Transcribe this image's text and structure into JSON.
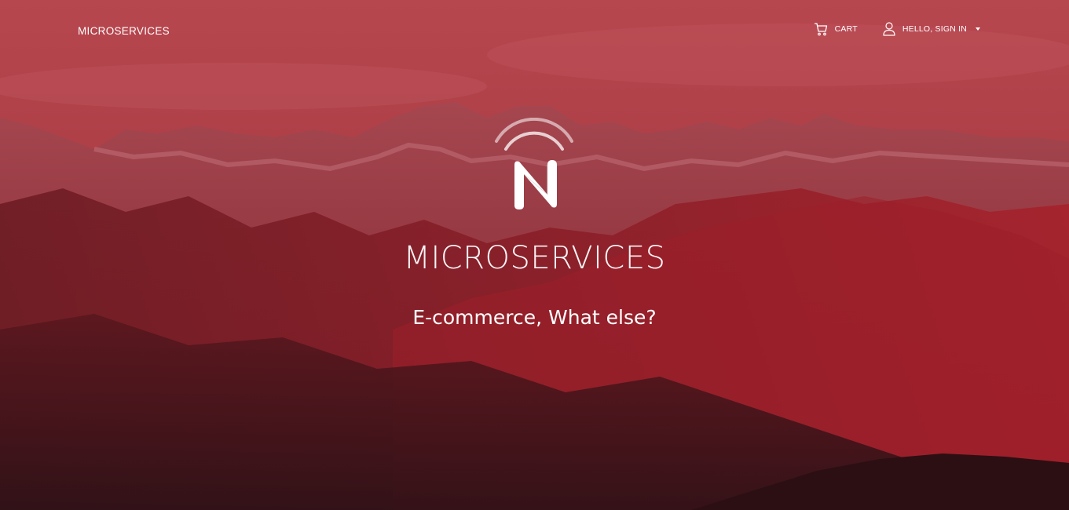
{
  "navbar": {
    "brand": "MICROSERVICES",
    "cart_label": "CART",
    "cart_icon": "cart-icon",
    "account_label": "HELLO, SIGN IN",
    "account_icon": "user-icon"
  },
  "hero": {
    "logo_letter": "N",
    "title": "MICROSERVICES",
    "subtitle": "E-commerce, What else?"
  },
  "colors": {
    "overlay": "#9b2530",
    "text": "#ffffff"
  }
}
